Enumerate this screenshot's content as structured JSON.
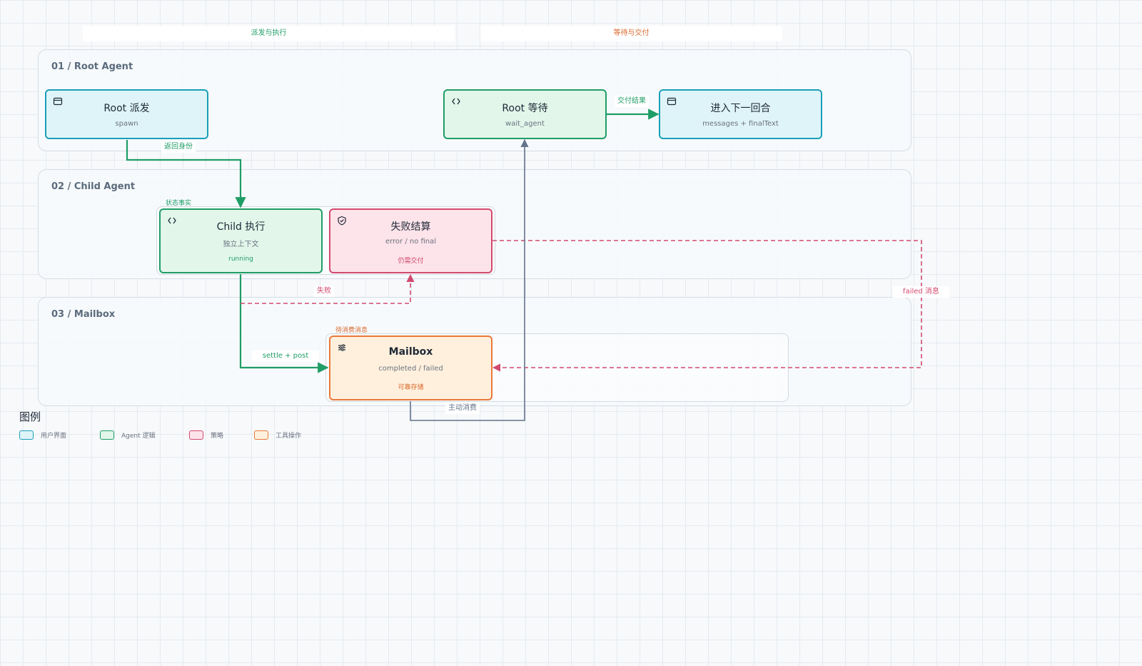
{
  "phases": [
    {
      "label": "派发与执行",
      "color": "#1f9d66"
    },
    {
      "label": "等待与交付",
      "color": "#d9682b"
    }
  ],
  "lanes": [
    {
      "title": "01 / Root Agent"
    },
    {
      "title": "02 / Child Agent"
    },
    {
      "title": "03 / Mailbox"
    }
  ],
  "groups": {
    "child_state": "状态事实",
    "mailbox_pending": "待消费消息"
  },
  "nodes": {
    "root_spawn": {
      "title": "Root 派发",
      "sub": "spawn",
      "icon": "window-icon"
    },
    "root_wait": {
      "title": "Root 等待",
      "sub": "wait_agent",
      "icon": "code-icon"
    },
    "next_round": {
      "title": "进入下一回合",
      "sub": "messages + finalText",
      "icon": "window-icon"
    },
    "child_run": {
      "title": "Child 执行",
      "sub": "独立上下文",
      "tag": "running",
      "icon": "code-icon"
    },
    "fail_settle": {
      "title": "失败结算",
      "sub": "error / no final",
      "tag": "仍需交付",
      "icon": "shield-icon"
    },
    "mailbox": {
      "title": "Mailbox",
      "sub": "completed / failed",
      "tag": "可靠存储",
      "icon": "sliders-icon"
    }
  },
  "edges": {
    "return_identity": "返回身份",
    "deliver_result": "交付结果",
    "fail": "失败",
    "settle_post": "settle + post",
    "consume": "主动消费",
    "failed_msg": "failed 消息"
  },
  "legend": {
    "title": "图例",
    "items": [
      {
        "label": "用户界面",
        "color": "#1a9fb8",
        "fill": "#dff4f8"
      },
      {
        "label": "Agent 逻辑",
        "color": "#1f9d66",
        "fill": "#e2f6ea"
      },
      {
        "label": "策略",
        "color": "#d24a6e",
        "fill": "#fde3ea"
      },
      {
        "label": "工具操作",
        "color": "#e9793a",
        "fill": "#fff0dd"
      }
    ]
  }
}
